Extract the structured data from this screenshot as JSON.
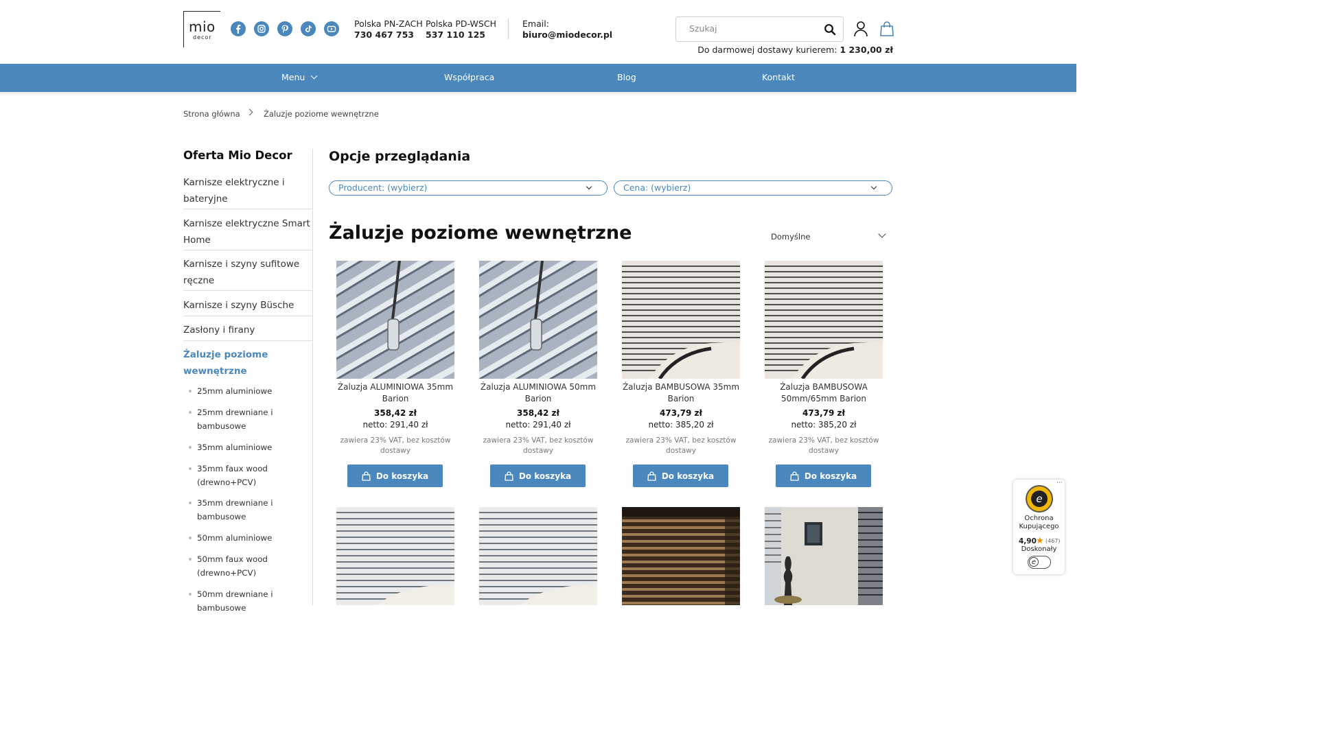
{
  "header": {
    "logo_main": "mio",
    "logo_sub": "decor",
    "social": [
      "facebook-icon",
      "instagram-icon",
      "pinterest-icon",
      "tiktok-icon",
      "youtube-icon"
    ],
    "contacts": [
      {
        "label": "Polska PN-ZACH",
        "value": "730 467 753"
      },
      {
        "label": "Polska PD-WSCH",
        "value": "537 110 125"
      },
      {
        "label": "Email:",
        "value": "biuro@miodecor.pl"
      }
    ],
    "search_placeholder": "Szukaj",
    "delivery_text": "Do darmowej dostawy kurierem:",
    "delivery_amount": "1 230,00 zł",
    "accent": "#4a87bd"
  },
  "nav": {
    "items": [
      "Menu",
      "Współpraca",
      "Blog",
      "Kontakt"
    ]
  },
  "breadcrumb": {
    "home": "Strona główna",
    "current": "Żaluzje poziome wewnętrzne"
  },
  "sidebar": {
    "title": "Oferta Mio Decor",
    "items": [
      "Karnisze elektryczne i bateryjne",
      "Karnisze elektryczne Smart Home",
      "Karnisze i szyny sufitowe ręczne",
      "Karnisze i szyny Büsche",
      "Zasłony i firany",
      "Żaluzje poziome wewnętrzne"
    ],
    "subitems": [
      "25mm aluminiowe",
      "25mm drewniane i bambusowe",
      "35mm aluminiowe",
      "35mm faux wood (drewno+PCV)",
      "35mm drewniane i bambusowe",
      "50mm aluminiowe",
      "50mm faux wood (drewno+PCV)",
      "50mm drewniane i bambusowe"
    ]
  },
  "main": {
    "options_title": "Opcje przeglądania",
    "filter_producer": "Producent: (wybierz)",
    "filter_price": "Cena: (wybierz)",
    "page_title": "Żaluzje poziome wewnętrzne",
    "sort_label": "Domyślne",
    "products": [
      {
        "name": "Żaluzja ALUMINIOWA 35mm Barion",
        "price": "358,42 zł",
        "netto": "netto: 291,40 zł",
        "vat": "zawiera 23% VAT, bez kosztów dostawy",
        "button": "Do koszyka"
      },
      {
        "name": "Żaluzja ALUMINIOWA 50mm Barion",
        "price": "358,42 zł",
        "netto": "netto: 291,40 zł",
        "vat": "zawiera 23% VAT, bez kosztów dostawy",
        "button": "Do koszyka"
      },
      {
        "name": "Żaluzja BAMBUSOWA 35mm Barion",
        "price": "473,79 zł",
        "netto": "netto: 385,20 zł",
        "vat": "zawiera 23% VAT, bez kosztów dostawy",
        "button": "Do koszyka"
      },
      {
        "name": "Żaluzja BAMBUSOWA 50mm/65mm Barion",
        "price": "473,79 zł",
        "netto": "netto: 385,20 zł",
        "vat": "zawiera 23% VAT, bez kosztów dostawy",
        "button": "Do koszyka"
      }
    ]
  },
  "trust": {
    "label": "Ochrona Kupującego",
    "score": "4,90",
    "count": "(467)",
    "rating": "Doskonały"
  }
}
